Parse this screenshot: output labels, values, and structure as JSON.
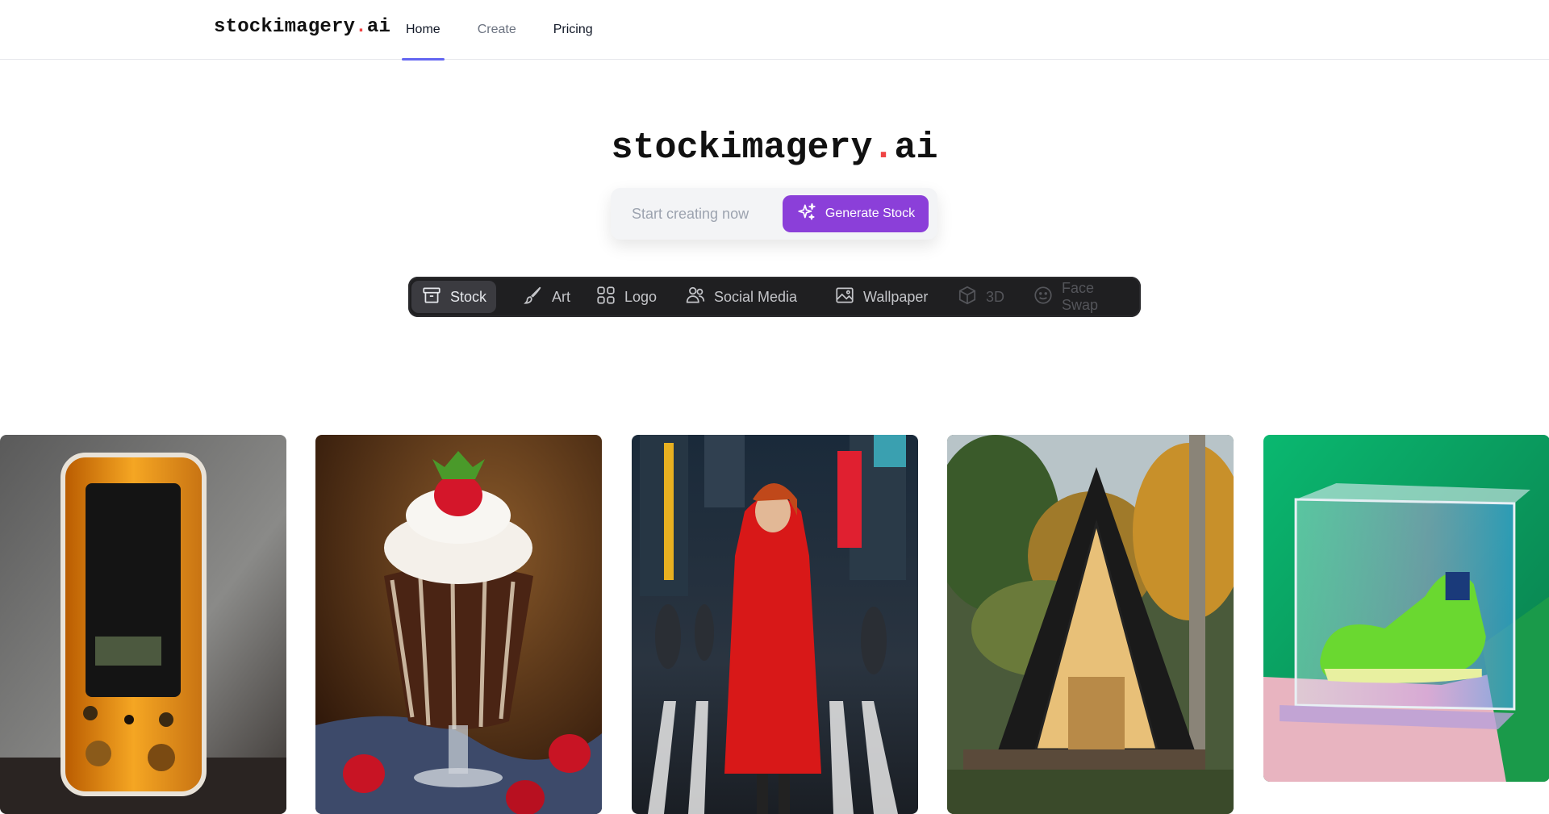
{
  "brand": {
    "name": "stockimagery",
    "dot": ".",
    "tld": "ai"
  },
  "nav": [
    {
      "label": "Home"
    },
    {
      "label": "Create"
    },
    {
      "label": "Pricing"
    }
  ],
  "hero": {
    "name": "stockimagery",
    "dot": ".",
    "tld": "ai"
  },
  "search": {
    "placeholder": "Start creating now",
    "value": ""
  },
  "generate_button": {
    "label": "Generate Stock",
    "icon": "sparkles-icon",
    "color": "#8b3fd9"
  },
  "categories": [
    {
      "label": "Stock",
      "icon": "archive-box-icon",
      "state": "active"
    },
    {
      "label": "Art",
      "icon": "paintbrush-icon",
      "state": "normal"
    },
    {
      "label": "Logo",
      "icon": "grid-squares-icon",
      "state": "normal"
    },
    {
      "label": "Social Media",
      "icon": "users-icon",
      "state": "normal"
    },
    {
      "label": "Wallpaper",
      "icon": "image-icon",
      "state": "normal"
    },
    {
      "label": "3D",
      "icon": "cube-icon",
      "state": "disabled"
    },
    {
      "label": "Face Swap",
      "icon": "smiley-icon",
      "state": "disabled"
    }
  ],
  "gallery": [
    {
      "image": "orange-transparent-phone"
    },
    {
      "image": "chocolate-sundae-strawberries"
    },
    {
      "image": "red-raincoat-woman-city-street"
    },
    {
      "image": "a-frame-cabin-forest"
    },
    {
      "image": "green-sneaker-acrylic-box"
    }
  ],
  "colors": {
    "accent": "#6366f1",
    "brand_dot": "#ef4444",
    "category_bar": "#1f1f21"
  }
}
